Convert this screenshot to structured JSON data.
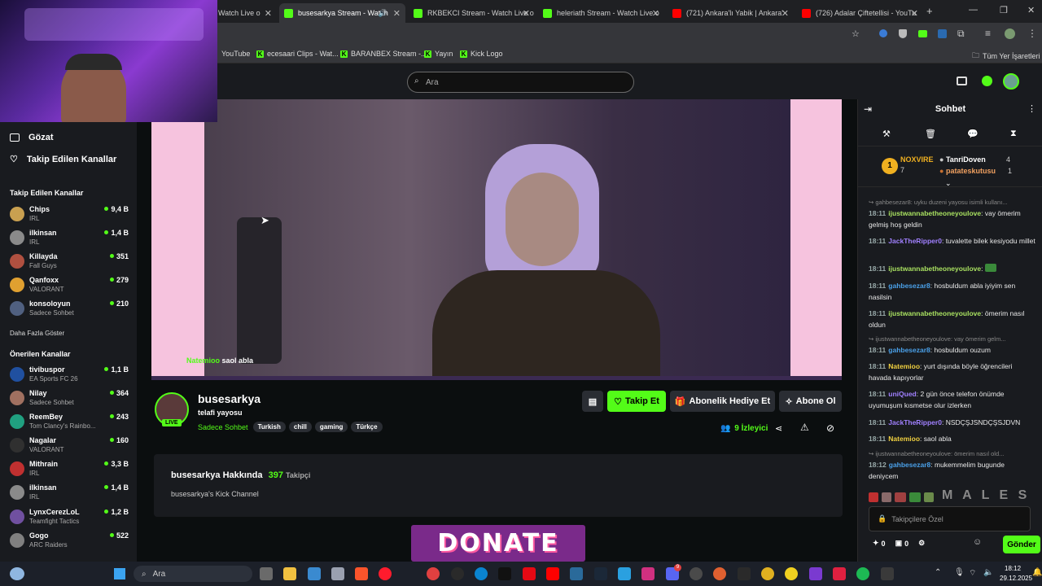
{
  "browser": {
    "tabs": [
      {
        "title": "Watch Live o",
        "color": "#53fc18"
      },
      {
        "title": "busesarkya Stream - Watch",
        "color": "#53fc18"
      },
      {
        "title": "RKBEKCI Stream - Watch Live o",
        "color": "#53fc18"
      },
      {
        "title": "heleriath Stream - Watch Live o",
        "color": "#53fc18"
      },
      {
        "title": "(721) Ankara'lı Yabik | Ankara'",
        "color": "#ff0000"
      },
      {
        "title": "(726) Adalar Çiftetellisi - YouTu",
        "color": "#ff0000"
      }
    ],
    "bookmarks": [
      {
        "label": "YouTube"
      },
      {
        "label": "ecesaari Clips - Wat..."
      },
      {
        "label": "BARANBEX Stream -..."
      },
      {
        "label": "Yayın"
      },
      {
        "label": "Kick Logo"
      }
    ],
    "all_bookmarks": "Tüm Yer İşaretleri"
  },
  "kick": {
    "search_placeholder": "Ara"
  },
  "sidebar": {
    "browse": "Gözat",
    "following": "Takip Edilen Kanallar",
    "followed_title": "Takip Edilen Kanallar",
    "followed": [
      {
        "name": "Chips",
        "category": "IRL",
        "viewers": "9,4 B",
        "color": "#c9a050"
      },
      {
        "name": "ilkinsan",
        "category": "IRL",
        "viewers": "1,4 B",
        "color": "#8a8a8a"
      },
      {
        "name": "Killayda",
        "category": "Fall Guys",
        "viewers": "351",
        "color": "#b05040"
      },
      {
        "name": "Qanfoxx",
        "category": "VALORANT",
        "viewers": "279",
        "color": "#e0a030"
      },
      {
        "name": "konsoloyun",
        "category": "Sadece Sohbet",
        "viewers": "210",
        "color": "#506080"
      }
    ],
    "show_more": "Daha Fazla Göster",
    "recommended_title": "Önerilen Kanallar",
    "recommended": [
      {
        "name": "tivibuspor",
        "category": "EA Sports FC 26",
        "viewers": "1,1 B",
        "color": "#2050a0"
      },
      {
        "name": "Nilay",
        "category": "Sadece Sohbet",
        "viewers": "364",
        "color": "#a07060"
      },
      {
        "name": "ReemBey",
        "category": "Tom Clancy's Rainbo...",
        "viewers": "243",
        "color": "#20a080"
      },
      {
        "name": "Nagalar",
        "category": "VALORANT",
        "viewers": "160",
        "color": "#303030"
      },
      {
        "name": "Mithrain",
        "category": "IRL",
        "viewers": "3,3 B",
        "color": "#c03030"
      },
      {
        "name": "ilkinsan",
        "category": "IRL",
        "viewers": "1,4 B",
        "color": "#8a8a8a"
      },
      {
        "name": "LynxCerezLoL",
        "category": "Teamfight Tactics",
        "viewers": "1,2 B",
        "color": "#7050a0"
      },
      {
        "name": "Gogo",
        "category": "ARC Raiders",
        "viewers": "522",
        "color": "#808080"
      }
    ]
  },
  "stream": {
    "overlay_name": "Natemioo",
    "overlay_msg": "saol abla",
    "live_badge": "LIVE",
    "channel": "busesarkya",
    "title": "telafi yayosu",
    "category": "Sadece Sohbet",
    "tags": [
      "Turkish",
      "chill",
      "gaming",
      "Türkçe"
    ],
    "follow": "Takip Et",
    "gift": "Abonelik Hediye Et",
    "subscribe": "Abone Ol",
    "viewers": "9",
    "viewers_label": "İzleyici",
    "about_title": "busesarkya Hakkında",
    "followers_count": "397",
    "followers_label": "Takipçi",
    "about_text": "busesarkya's Kick Channel",
    "donate": "DONATE"
  },
  "chat": {
    "title": "Sohbet",
    "leaders": [
      {
        "rank": "1",
        "name": "NOXVIRE",
        "count": "7"
      },
      {
        "name": "TanriDoven",
        "count": "4"
      },
      {
        "name": "patateskutusu",
        "count": "1"
      }
    ],
    "messages": [
      {
        "reply": "gahbesezar8: uyku duzeni yayosu isimli kullanı..."
      },
      {
        "time": "18:11",
        "user": "ijustwannabetheoneyoulove",
        "color": "#a8e060",
        "text": "vay ömerim gelmiş hoş geldin"
      },
      {
        "time": "18:11",
        "user": "JackTheRipper0",
        "color": "#a080ff",
        "text": "tuvalette bilek kesiyodu millet"
      },
      {
        "time": "18:11",
        "user": "ijustwannabetheoneyoulove",
        "color": "#a8e060",
        "text": ""
      },
      {
        "time": "18:11",
        "user": "gahbesezar8",
        "color": "#4aa0e8",
        "text": "hosbuldum abla iyiyim sen nasilsin"
      },
      {
        "time": "18:11",
        "user": "ijustwannabetheoneyoulove",
        "color": "#a8e060",
        "text": "ömerim nasıl oldun"
      },
      {
        "reply": "ijustwannabetheoneyoulove: vay ömerim gelm..."
      },
      {
        "time": "18:11",
        "user": "gahbesezar8",
        "color": "#4aa0e8",
        "text": "hosbuldum ouzum"
      },
      {
        "time": "18:11",
        "user": "Natemioo",
        "color": "#f0d040",
        "text": "yurt dışında böyle öğrencileri havada kapıyorlar"
      },
      {
        "time": "18:11",
        "user": "uniQued",
        "color": "#a080ff",
        "text": "2 gün önce telefon önümde uyumuşum kısmetse olur izlerken"
      },
      {
        "time": "18:11",
        "user": "JackTheRipper0",
        "color": "#a080ff",
        "text": "NSDÇŞJSNDÇŞSJDVN"
      },
      {
        "time": "18:11",
        "user": "Natemioo",
        "color": "#f0d040",
        "text": "saol abla"
      },
      {
        "reply": "ijustwannabetheoneyoulove: ömerim nasıl old..."
      },
      {
        "time": "18:12",
        "user": "gahbesezar8",
        "color": "#4aa0e8",
        "text": "mukemmelim bugunde deniycem"
      }
    ],
    "emote_letters": "M A L E S",
    "input_placeholder": "Takipçilere Özel",
    "count_a": "0",
    "count_b": "0",
    "send": "Gönder"
  },
  "taskbar": {
    "search": "Ara",
    "time": "18:12",
    "date": "29.12.2025",
    "notif_badge": "9"
  }
}
